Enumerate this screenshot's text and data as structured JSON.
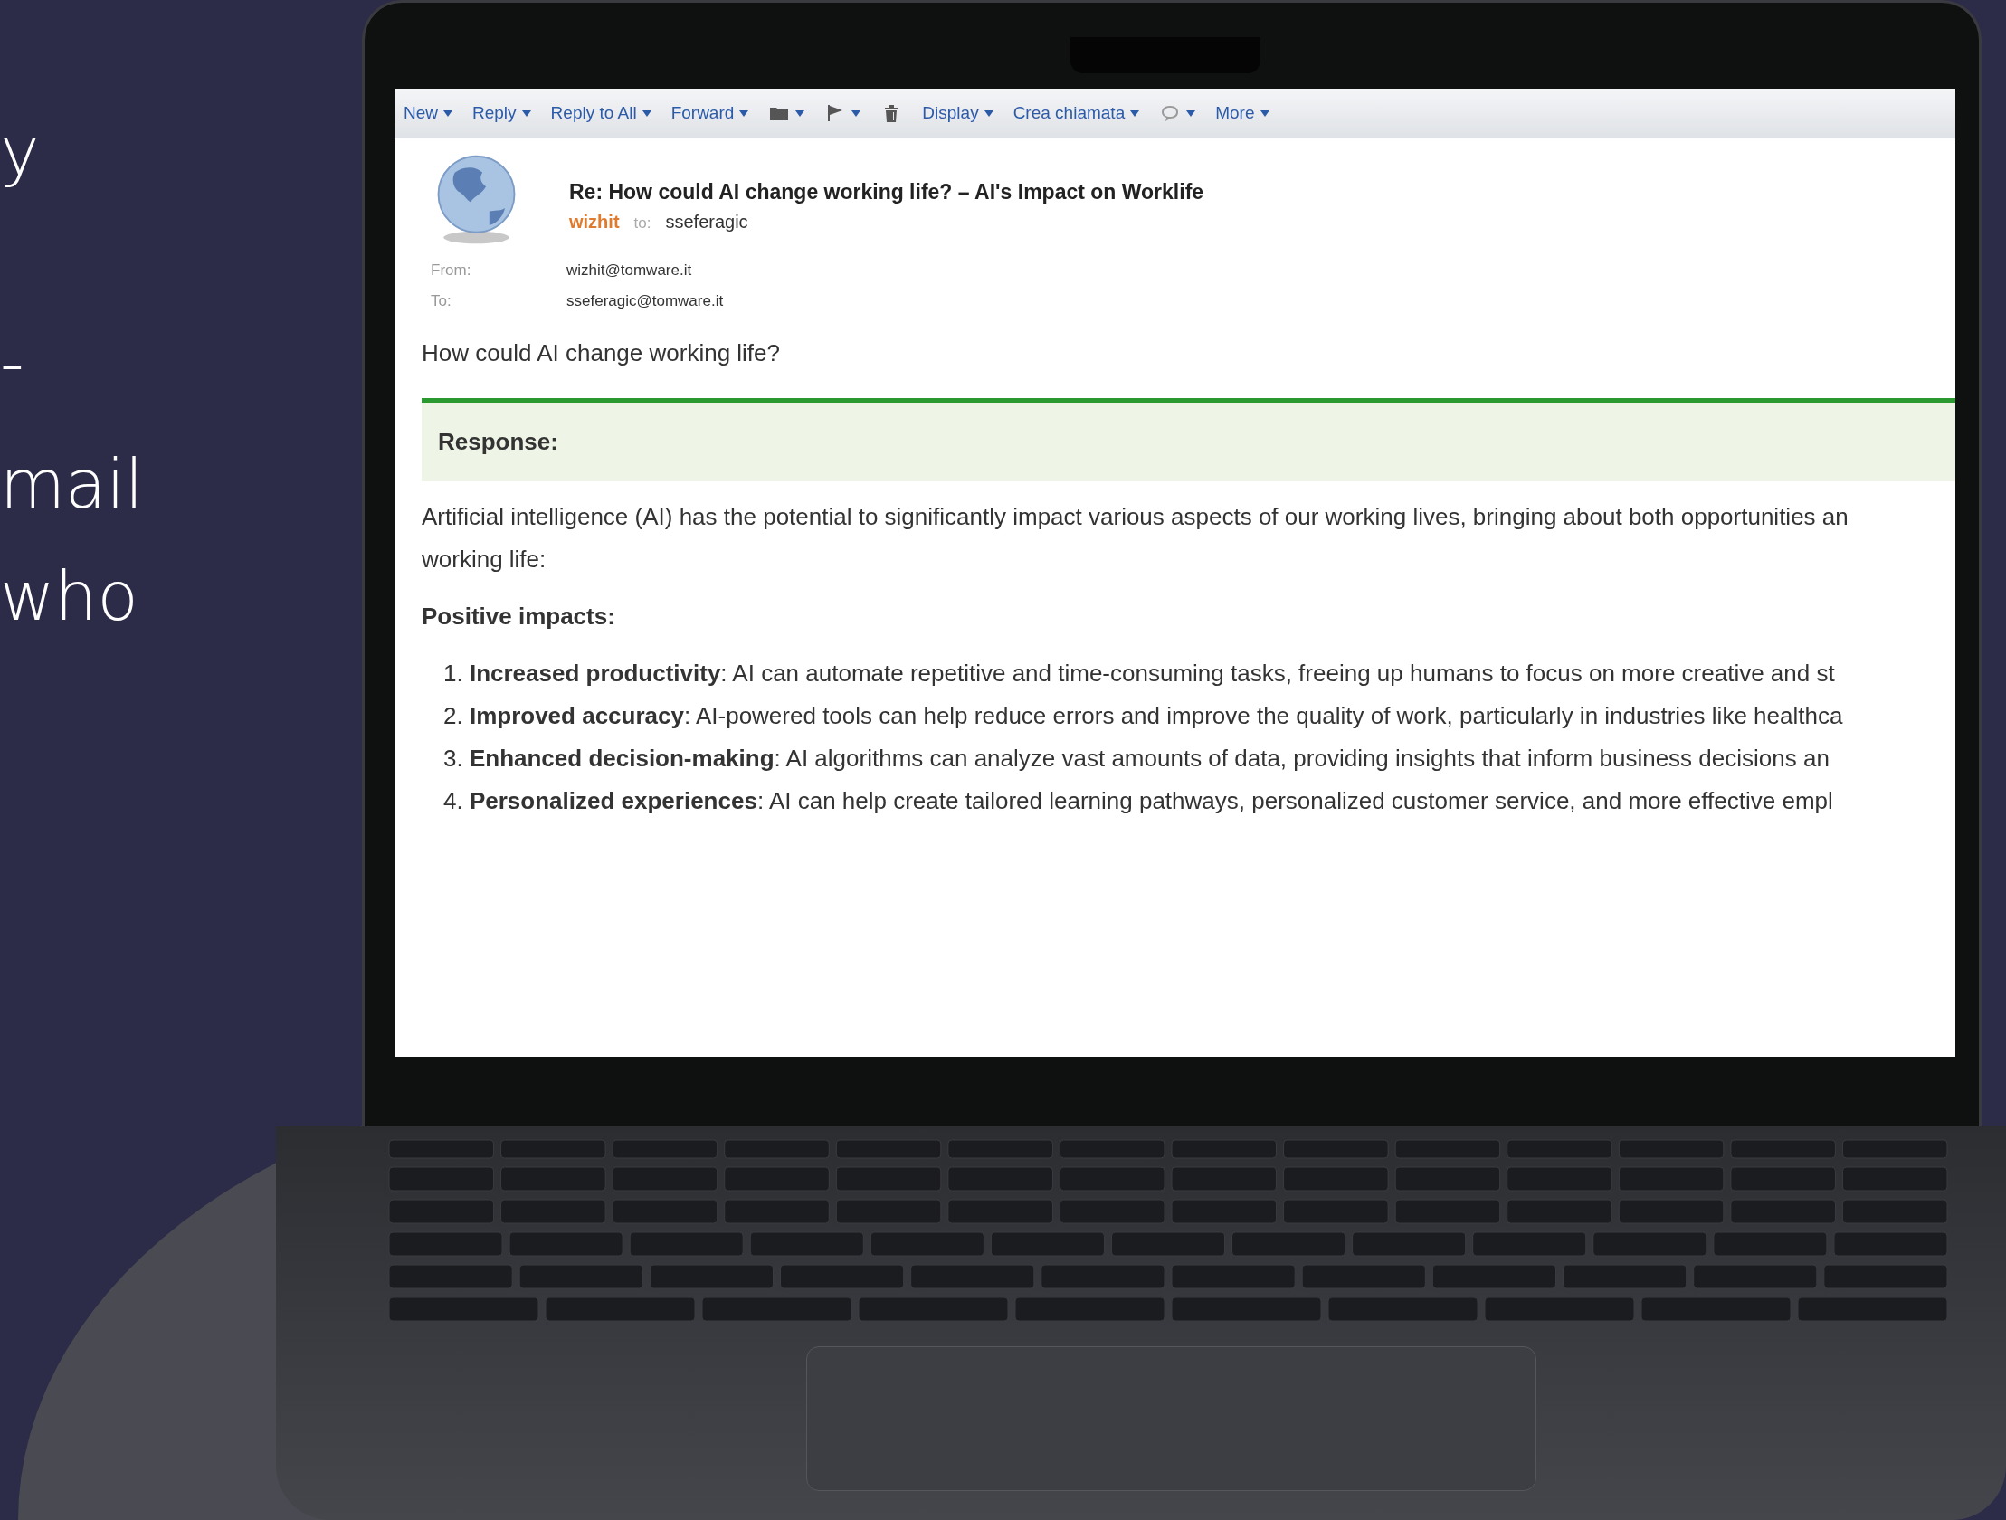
{
  "slogan_fragments": [
    "y",
    "-",
    "mail",
    "who"
  ],
  "email": {
    "toolbar": [
      {
        "kind": "menu",
        "label": "New",
        "dropdown": true
      },
      {
        "kind": "menu",
        "label": "Reply",
        "dropdown": true
      },
      {
        "kind": "menu",
        "label": "Reply to All",
        "dropdown": true
      },
      {
        "kind": "menu",
        "label": "Forward",
        "dropdown": true
      },
      {
        "kind": "folder",
        "dropdown": true
      },
      {
        "kind": "flag",
        "dropdown": true
      },
      {
        "kind": "trash",
        "dropdown": false
      },
      {
        "kind": "menu",
        "label": "Display",
        "dropdown": true
      },
      {
        "kind": "menu",
        "label": "Crea chiamata",
        "dropdown": true
      },
      {
        "kind": "chat",
        "dropdown": true
      },
      {
        "kind": "menu",
        "label": "More",
        "dropdown": true
      }
    ],
    "subject": "Re: How could AI change working life? – AI's Impact on Worklife",
    "sender": "wizhit",
    "to_label": "to:",
    "recipient": "sseferagic",
    "fields": [
      {
        "label": "From:",
        "value": "wizhit@tomware.it"
      },
      {
        "label": "To:",
        "value": "sseferagic@tomware.it"
      }
    ],
    "question": "How could AI change working life?",
    "response_label": "Response:",
    "intro_lines": [
      "Artificial intelligence (AI) has the potential to significantly impact various aspects of our working lives, bringing about both opportunities an",
      "working life:"
    ],
    "section_title": "Positive impacts:",
    "list": [
      {
        "number": "1.",
        "text": "**Increased productivity**: AI can automate repetitive and time-consuming tasks, freeing up humans to focus on more creative and st"
      },
      {
        "number": "2.",
        "text": "**Improved accuracy**: AI-powered tools can help reduce errors and improve the quality of work, particularly in industries like healthca"
      },
      {
        "number": "3.",
        "text": "**Enhanced decision-making**: AI algorithms can analyze vast amounts of data, providing insights that inform business decisions an"
      },
      {
        "number": "4.",
        "text": "**Personalized experiences**: AI can help create tailored learning pathways, personalized customer service, and more effective empl"
      }
    ]
  }
}
